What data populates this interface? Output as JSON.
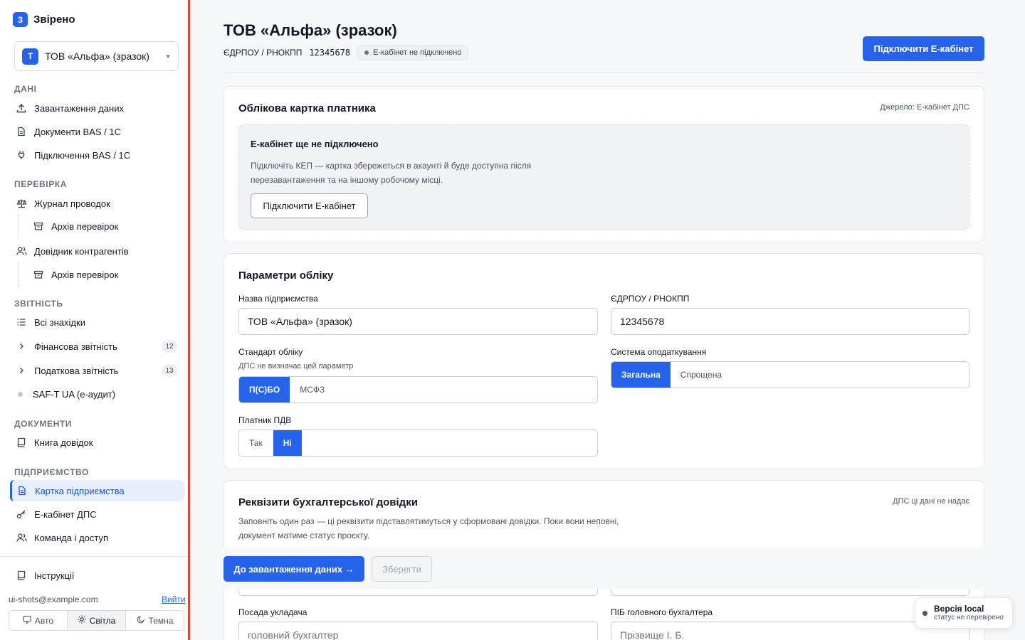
{
  "brand": {
    "logo_letter": "З",
    "name": "Звірено"
  },
  "company_switcher": {
    "avatar_letter": "Т",
    "name": "ТОВ «Альфа» (зразок)"
  },
  "sidebar": {
    "sections": {
      "data": "ДАНІ",
      "check": "ПЕРЕВІРКА",
      "reporting": "ЗВІТНІСТЬ",
      "documents": "ДОКУМЕНТИ",
      "company": "ПІДПРИЄМСТВО"
    },
    "items": {
      "upload": "Завантаження даних",
      "bas_docs": "Документи BAS / 1С",
      "bas_connect": "Підключення BAS / 1С",
      "journal": "Журнал проводок",
      "journal_archive": "Архів перевірок",
      "counterparties": "Довідник контрагентів",
      "counterparties_archive": "Архів перевірок",
      "all_findings": "Всі знахідки",
      "financial": "Фінансова звітність",
      "financial_count": "12",
      "tax": "Податкова звітність",
      "tax_count": "13",
      "saft": "SAF-T UA (е-аудит)",
      "book": "Книга довідок",
      "company_card": "Картка підприємства",
      "ecabinet": "Е-кабінет ДПС",
      "team": "Команда і доступ",
      "instructions": "Інструкції"
    },
    "user_email": "ui-shots@example.com",
    "logout": "Вийти",
    "theme": {
      "auto": "Авто",
      "light": "Світла",
      "dark": "Темна",
      "selected": "Світла"
    }
  },
  "header": {
    "title": "ТОВ «Альфа» (зразок)",
    "id_label": "ЄДРПОУ / РНОКПП",
    "id_value": "12345678",
    "status": "Е-кабінет не підключено",
    "connect_button": "Підключити Е-кабінет"
  },
  "taxpayer_card": {
    "title": "Облікова картка платника",
    "source": "Джерело: Е-кабінет ДПС",
    "empty_title": "Е-кабінет ще не підключено",
    "empty_text": "Підключіть КЕП — картка збережеться в акаунті й буде доступна після перезавантаження та на іншому робочому місці.",
    "connect_button": "Підключити Е-кабінет"
  },
  "accounting_params": {
    "title": "Параметри обліку",
    "company_name_label": "Назва підприємства",
    "company_name_value": "ТОВ «Альфа» (зразок)",
    "edrpou_label": "ЄДРПОУ / РНОКПП",
    "edrpou_value": "12345678",
    "standard_label": "Стандарт обліку",
    "standard_hint": "ДПС не визначає цей параметр",
    "standard_options": [
      "П(С)БО",
      "МСФЗ"
    ],
    "standard_selected": "П(С)БО",
    "tax_system_label": "Система оподаткування",
    "tax_system_options": [
      "Загальна",
      "Спрощена"
    ],
    "tax_system_selected": "Загальна",
    "vat_label": "Платник ПДВ",
    "vat_options": [
      "Так",
      "Ні"
    ],
    "vat_selected": "Ні"
  },
  "certificate_details": {
    "title": "Реквізити бухгалтерської довідки",
    "meta": "ДПС ці дані не надає",
    "description": "Заповніть один раз — ці реквізити підставлятимуться у сформовані довідки. Поки вони неповні, документ матиме статус проєкту.",
    "position_label": "Посада укладача",
    "position_placeholder": "головний бухгалтер",
    "chief_accountant_label": "ПІБ головного бухгалтера",
    "chief_accountant_placeholder": "Прізвище І. Б."
  },
  "action_bar": {
    "next_button": "До завантаження даних →",
    "save_button": "Зберегти"
  },
  "version": {
    "title": "Версія local",
    "status": "статус не перевірено"
  },
  "colors": {
    "accent": "#2563eb",
    "sidebar_border": "#d9463b"
  }
}
